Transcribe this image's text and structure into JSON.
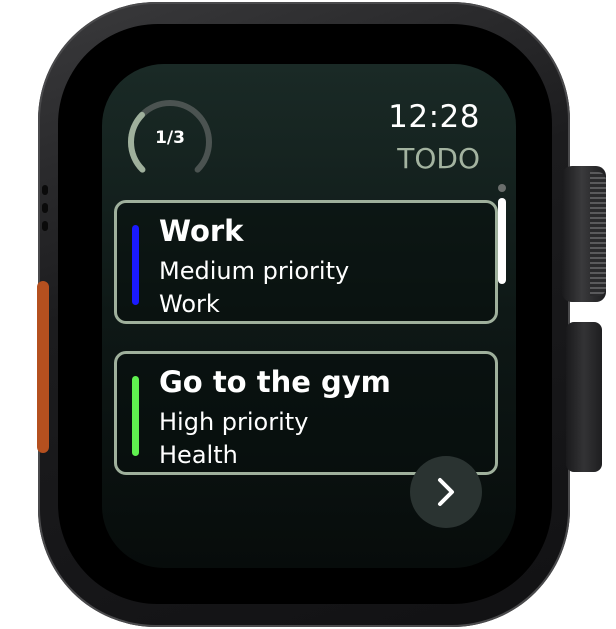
{
  "status": {
    "progress_label": "1/3",
    "progress_fraction": 0.33,
    "time": "12:28",
    "app_title": "TODO"
  },
  "tasks": [
    {
      "title": "Work",
      "priority": "Medium priority",
      "category": "Work",
      "color": "#1a1aff"
    },
    {
      "title": "Go to the gym",
      "priority": "High priority",
      "category": "Health",
      "color": "#5ff04f"
    }
  ],
  "navigation": {
    "next_icon": "chevron-right-icon"
  },
  "colors": {
    "card_border": "#9fb09c",
    "title_accent": "#a3b3a0",
    "action_button": "#b5501f"
  }
}
